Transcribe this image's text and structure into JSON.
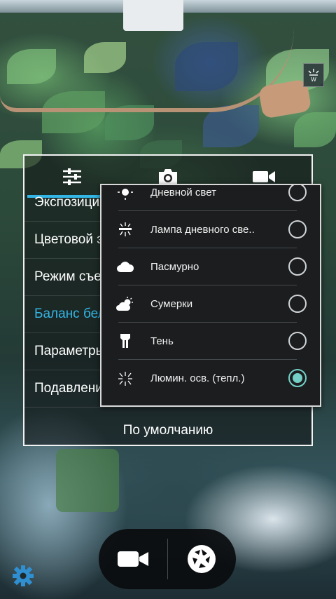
{
  "settings": {
    "tabs": [
      {
        "icon": "sliders-icon"
      },
      {
        "icon": "camera-icon"
      },
      {
        "icon": "video-camera-icon"
      }
    ],
    "items": [
      {
        "label": "Экспозиция"
      },
      {
        "label": "Цветовой эффект"
      },
      {
        "label": "Режим съемки"
      },
      {
        "label": "Баланс белого"
      },
      {
        "label": "Параметры"
      },
      {
        "label": "Подавление мерцания"
      }
    ],
    "default_label": "По умолчанию"
  },
  "white_balance": {
    "options": [
      {
        "label": "Дневной свет",
        "icon": "daylight-icon",
        "checked": false
      },
      {
        "label": "Лампа дневного све..",
        "icon": "fluorescent-icon",
        "checked": false
      },
      {
        "label": "Пасмурно",
        "icon": "cloudy-icon",
        "checked": false
      },
      {
        "label": "Сумерки",
        "icon": "twilight-icon",
        "checked": false
      },
      {
        "label": "Тень",
        "icon": "shade-icon",
        "checked": false
      },
      {
        "label": "Люмин. осв. (тепл.)",
        "icon": "warm-fluorescent-icon",
        "checked": true
      }
    ]
  },
  "indicator": {
    "icon": "white-balance-warm-fluorescent-icon"
  },
  "controls": {
    "video_button_icon": "video-camera-icon",
    "shutter_button_icon": "shutter-icon",
    "settings_icon": "gear-icon"
  },
  "colors": {
    "accent": "#33b5e5",
    "radio_checked": "#74d0c6"
  }
}
